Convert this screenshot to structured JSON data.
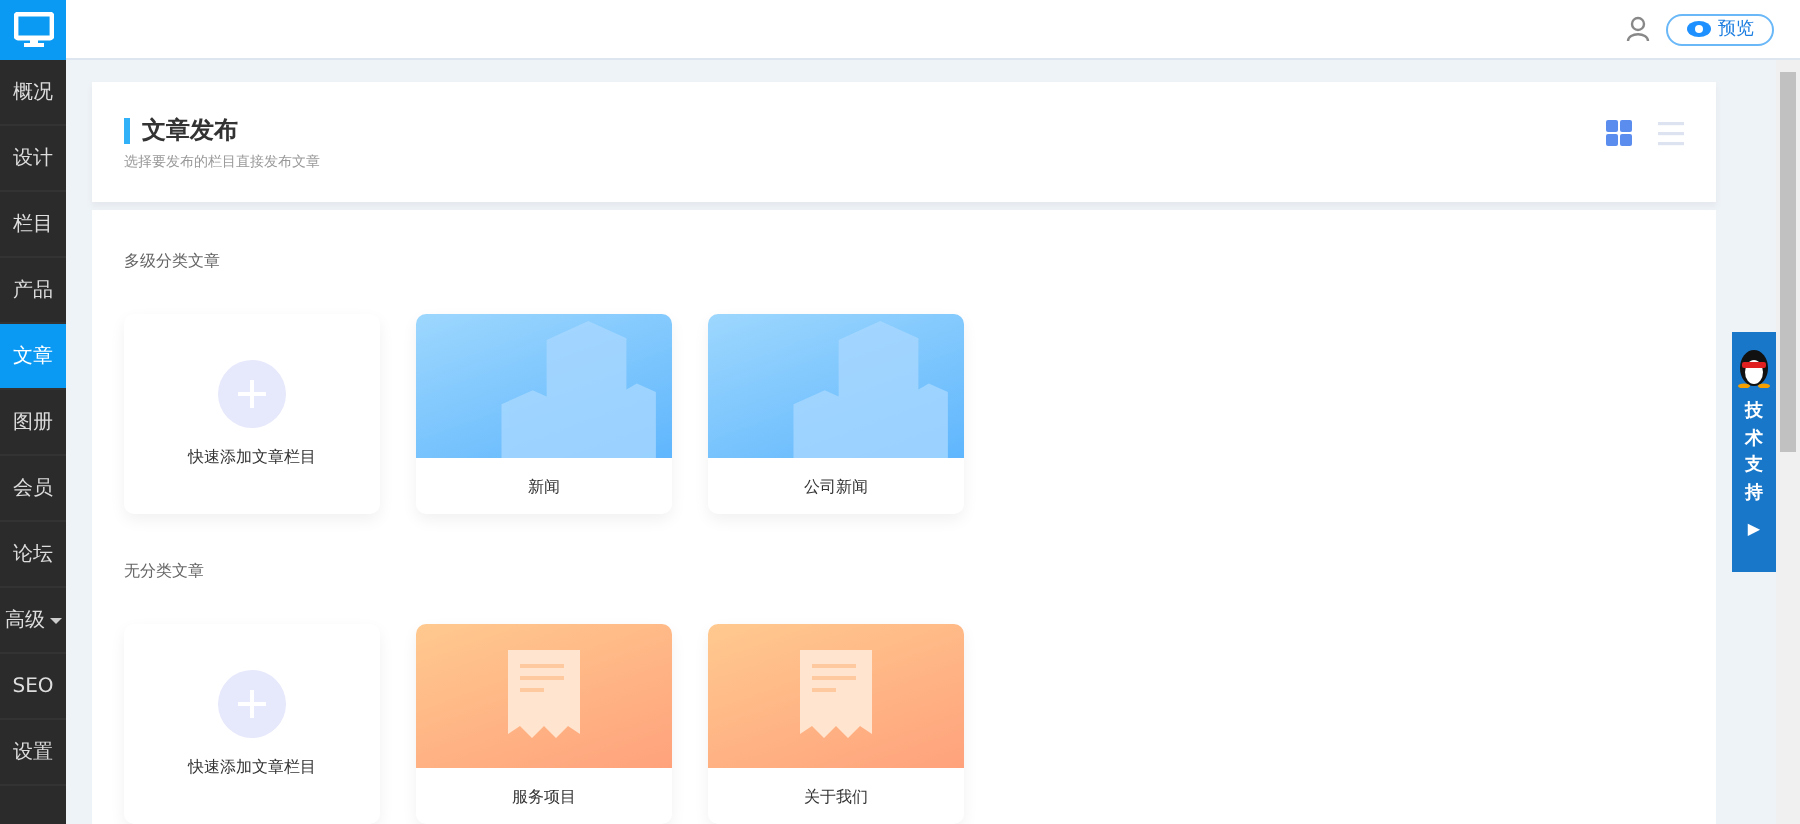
{
  "sidebar": {
    "items": [
      {
        "label": "概况",
        "selected": false,
        "dropdown": false
      },
      {
        "label": "设计",
        "selected": false,
        "dropdown": false
      },
      {
        "label": "栏目",
        "selected": false,
        "dropdown": false
      },
      {
        "label": "产品",
        "selected": false,
        "dropdown": false
      },
      {
        "label": "文章",
        "selected": true,
        "dropdown": false
      },
      {
        "label": "图册",
        "selected": false,
        "dropdown": false
      },
      {
        "label": "会员",
        "selected": false,
        "dropdown": false
      },
      {
        "label": "论坛",
        "selected": false,
        "dropdown": false
      },
      {
        "label": "高级",
        "selected": false,
        "dropdown": true
      },
      {
        "label": "SEO",
        "selected": false,
        "dropdown": false
      },
      {
        "label": "设置",
        "selected": false,
        "dropdown": false
      }
    ]
  },
  "topbar": {
    "preview_button": "预览"
  },
  "header": {
    "title": "文章发布",
    "subtitle": "选择要发布的栏目直接发布文章",
    "views": [
      {
        "kind": "grid",
        "selected": true
      },
      {
        "kind": "list",
        "selected": false
      }
    ]
  },
  "sections": [
    {
      "title": "多级分类文章",
      "cards": [
        {
          "kind": "add",
          "label": "快速添加文章栏目"
        },
        {
          "kind": "buildings",
          "label": "新闻"
        },
        {
          "kind": "buildings",
          "label": "公司新闻"
        }
      ]
    },
    {
      "title": "无分类文章",
      "cards": [
        {
          "kind": "add",
          "label": "快速添加文章栏目"
        },
        {
          "kind": "receipt",
          "label": "服务项目"
        },
        {
          "kind": "receipt",
          "label": "关于我们"
        }
      ]
    }
  ],
  "support_widget": {
    "label": "技术支持",
    "arrow": "▶"
  }
}
